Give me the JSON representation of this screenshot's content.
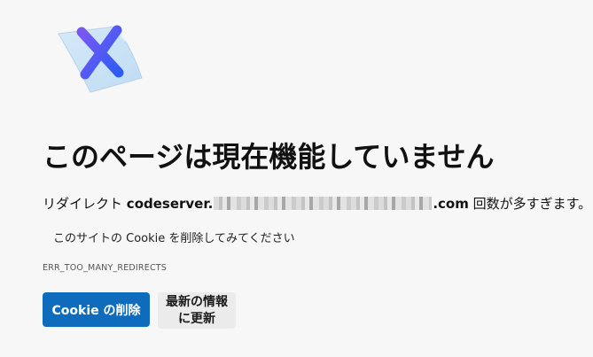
{
  "error": {
    "icon": "broken-page-x-icon",
    "title": "このページは現在機能していません",
    "redirect_prefix": "リダイレクト",
    "host_prefix": "codeserver.",
    "host_suffix": ".com",
    "redirect_suffix": "回数が多すぎます。",
    "suggestion": "このサイトの Cookie を削除してみてください",
    "code": "ERR_TOO_MANY_REDIRECTS"
  },
  "actions": {
    "delete_cookies_label": "Cookie の削除",
    "refresh_label": "最新の情報\nに更新"
  },
  "colors": {
    "primary_button": "#0f6cbd",
    "secondary_button": "#ebebeb",
    "background": "#f7f7f7",
    "icon_gradient_start": "#6f4cf0",
    "icon_gradient_end": "#2f5cf5"
  }
}
